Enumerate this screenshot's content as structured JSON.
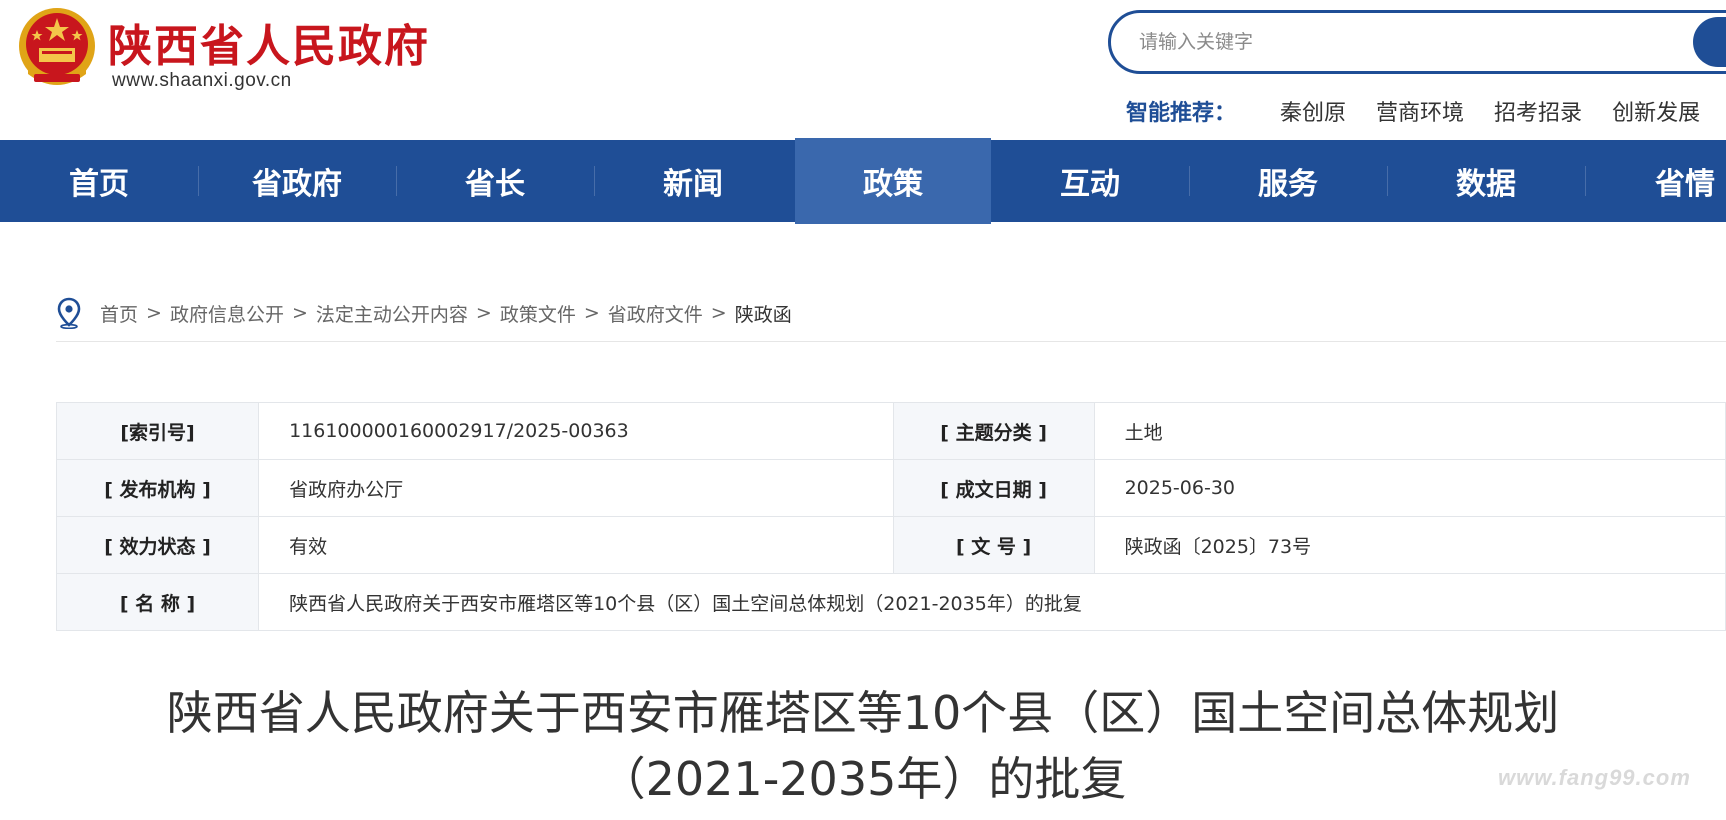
{
  "header": {
    "logo_icon": "national-emblem",
    "site_title": "陕西省人民政府",
    "site_url": "www.shaanxi.gov.cn",
    "search": {
      "placeholder": "请输入关键字",
      "button_icon": "search-icon"
    },
    "recommend": {
      "label": "智能推荐：",
      "items": [
        "秦创原",
        "营商环境",
        "招考招录",
        "创新发展"
      ]
    }
  },
  "nav": {
    "items": [
      {
        "label": "首页"
      },
      {
        "label": "省政府"
      },
      {
        "label": "省长"
      },
      {
        "label": "新闻"
      },
      {
        "label": "政策",
        "active": true
      },
      {
        "label": "互动"
      },
      {
        "label": "服务"
      },
      {
        "label": "数据"
      },
      {
        "label": "省情"
      }
    ]
  },
  "breadcrumb": {
    "icon": "location-pin-icon",
    "separator": ">",
    "items": [
      "首页",
      "政府信息公开",
      "法定主动公开内容",
      "政策文件",
      "省政府文件",
      "陕政函"
    ]
  },
  "meta": {
    "index_label": "[索引号]",
    "index_value": "116100000160002917/2025-00363",
    "topic_label": "[ 主题分类 ]",
    "topic_value": "土地",
    "issuer_label": "[ 发布机构 ]",
    "issuer_value": "省政府办公厅",
    "date_label": "[ 成文日期 ]",
    "date_value": "2025-06-30",
    "status_label": "[ 效力状态 ]",
    "status_value": "有效",
    "docno_label": "[ 文 号 ]",
    "docno_value": "陕政函〔2025〕73号",
    "name_label": "[ 名 称 ]",
    "name_value": "陕西省人民政府关于西安市雁塔区等10个县（区）国土空间总体规划（2021-2035年）的批复"
  },
  "document": {
    "title_line1": "陕西省人民政府关于西安市雁塔区等10个县（区）国土空间总体规划",
    "title_line2": "（2021-2035年）的批复"
  },
  "watermark": "www.fang99.com",
  "colors": {
    "brand_red": "#c8161d",
    "nav_blue": "#1f4e96",
    "nav_active": "#3a68ad"
  }
}
